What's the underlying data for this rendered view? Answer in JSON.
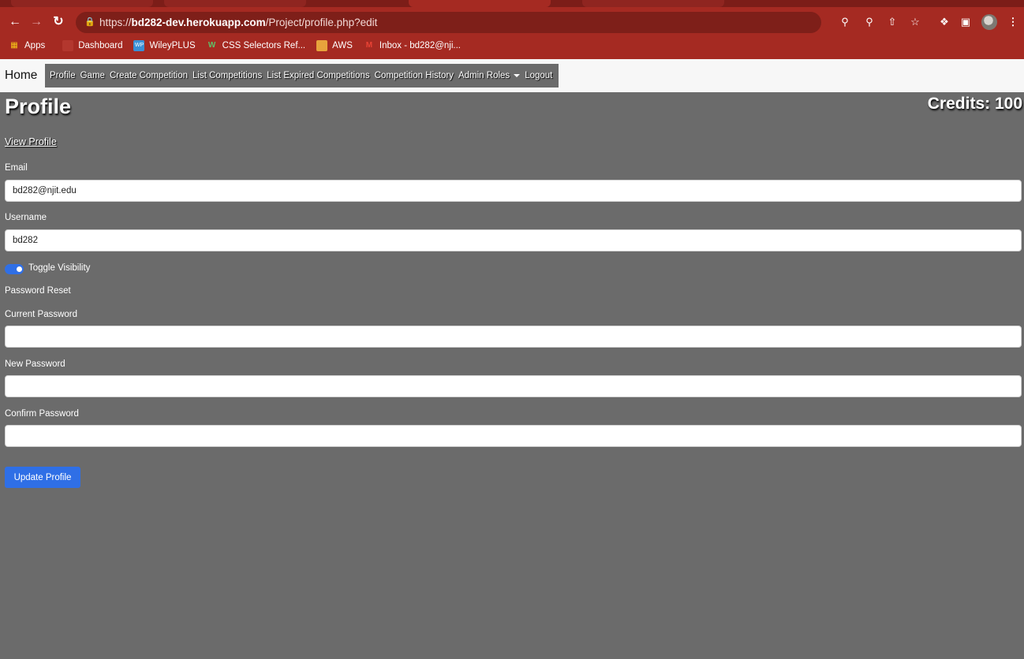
{
  "browser": {
    "url_prefix": "https://",
    "url_host": "bd282-dev.herokuapp.com",
    "url_path": "/Project/profile.php?edit",
    "bookmarks": [
      {
        "label": "Apps",
        "icon": "apps-grid-icon"
      },
      {
        "label": "Dashboard",
        "icon": "dashboard-icon"
      },
      {
        "label": "WileyPLUS",
        "icon": "wileyplus-icon"
      },
      {
        "label": "CSS Selectors Ref...",
        "icon": "w3-icon"
      },
      {
        "label": "AWS",
        "icon": "aws-box-icon"
      },
      {
        "label": "Inbox - bd282@nji...",
        "icon": "gmail-icon"
      }
    ]
  },
  "nav": {
    "brand": "Home",
    "links": [
      "Profile",
      "Game",
      "Create Competition",
      "List Competitions",
      "List Expired Competitions",
      "Competition History",
      "Admin Roles",
      "Logout"
    ]
  },
  "page": {
    "title": "Profile",
    "credits": "Credits: 100",
    "view_profile_link": "View Profile",
    "email_label": "Email",
    "email_value": "bd282@njit.edu",
    "username_label": "Username",
    "username_value": "bd282",
    "toggle_label": "Toggle Visibility",
    "password_reset_label": "Password Reset",
    "current_password_label": "Current Password",
    "new_password_label": "New Password",
    "confirm_password_label": "Confirm Password",
    "submit_label": "Update Profile"
  },
  "colors": {
    "browser_chrome": "#a52a22",
    "page_background": "#6b6b6b",
    "accent_blue": "#2f6fe6"
  }
}
